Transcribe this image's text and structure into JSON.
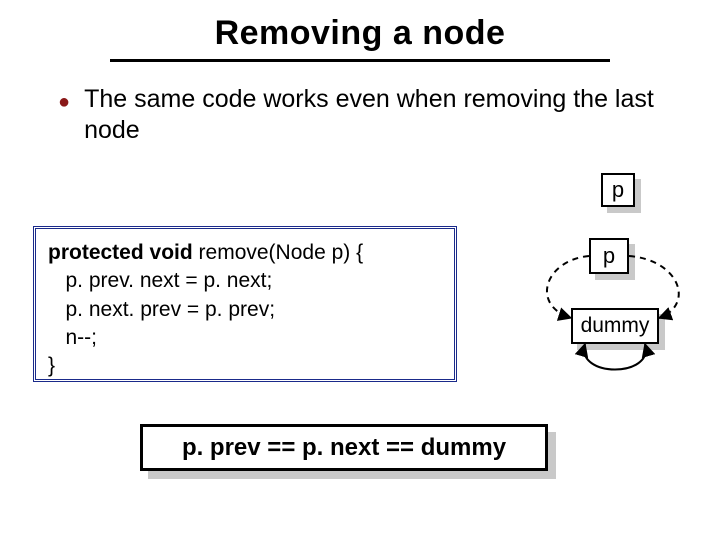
{
  "title": "Removing a node",
  "bullet": "The same code works even when removing the last node",
  "code": {
    "sig_kw": "protected void",
    "sig_rest": " remove(Node p) {",
    "l2": "   p. prev. next = p. next;",
    "l3": "   p. next. prev = p. prev;",
    "l4": "   n--;",
    "l5": "}"
  },
  "diagram": {
    "p_label": "p",
    "node_p": "p",
    "node_dummy": "dummy"
  },
  "equality": "p. prev == p. next == dummy"
}
